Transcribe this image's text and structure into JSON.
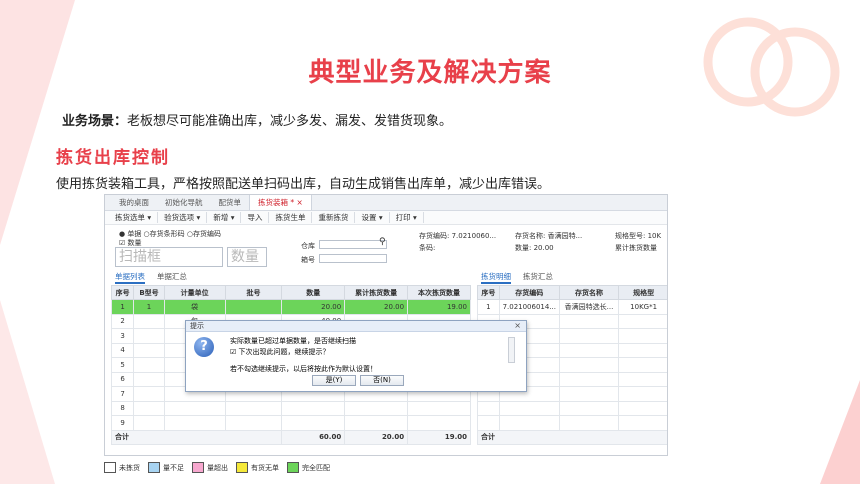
{
  "heading": "典型业务及解决方案",
  "scenario": {
    "label": "业务场景：",
    "text": "老板想尽可能准确出库，减少多发、漏发、发错货现象。"
  },
  "section": {
    "title": "拣货出库控制",
    "desc": "使用拣货装箱工具，严格按照配送单扫码出库，自动生成销售出库单，减少出库错误。"
  },
  "app": {
    "tabs": [
      "我的桌面",
      "初始化导航",
      "配货单",
      "拣货装箱 *"
    ],
    "tab_close": "×",
    "toolbar": [
      "拣货选单 ▾",
      "验货选项 ▾",
      "新增 ▾",
      "导入",
      "拣货生单",
      "重新拣货",
      "设置 ▾",
      "打印 ▾"
    ],
    "form": {
      "radio1": "● 单据 ○存货条形码 ○存货编码",
      "chk_qty": "☑ 数量",
      "scan_placeholder": "扫描框",
      "qty_placeholder": "数量",
      "warehouse_label": "仓库",
      "slot_label": "箱号",
      "inv_code": "存货编码: 7.0210060...",
      "inv_name": "存货名称: 香满园特...",
      "spec": "规格型号: 10K",
      "barcode": "条码:",
      "qty": "数量: 20.00",
      "acc_qty": "累计拣货数量"
    },
    "left_tabs": [
      "单据列表",
      "单据汇总"
    ],
    "right_tabs": [
      "拣货明细",
      "拣货汇总"
    ],
    "left_table": {
      "headers": [
        "序号",
        "B型号",
        "计量单位",
        "批号",
        "数量",
        "累计拣货数量",
        "本次拣货数量"
      ],
      "rows": [
        [
          "1",
          "1",
          "袋",
          "",
          "20.00",
          "20.00",
          "19.00"
        ],
        [
          "2",
          "",
          "包",
          "",
          "40.00",
          "",
          ""
        ],
        [
          "3",
          "",
          "",
          "",
          "",
          "",
          ""
        ],
        [
          "4",
          "",
          "",
          "",
          "",
          "",
          ""
        ],
        [
          "5",
          "",
          "",
          "",
          "",
          "",
          ""
        ],
        [
          "6",
          "",
          "",
          "",
          "",
          "",
          ""
        ],
        [
          "7",
          "",
          "",
          "",
          "",
          "",
          ""
        ],
        [
          "8",
          "",
          "",
          "",
          "",
          "",
          ""
        ],
        [
          "9",
          "",
          "",
          "",
          "",
          "",
          ""
        ]
      ],
      "total": [
        "合计",
        "",
        "",
        "",
        "60.00",
        "20.00",
        "19.00"
      ]
    },
    "right_table": {
      "headers": [
        "序号",
        "存货编码",
        "存货名称",
        "规格型"
      ],
      "rows": [
        [
          "1",
          "7.021006014...",
          "香满园特选长...",
          "10KG*1"
        ]
      ],
      "total_label": "合计"
    },
    "dialog": {
      "title": "提示",
      "close": "×",
      "icon": "?",
      "message": "实际数量已超过单据数量，是否继续扫描",
      "checkbox": "☑ 下次出现此问题，继续提示？",
      "note": "若不勾选继续提示，以后将按此作为默认设置！",
      "yes": "是(Y)",
      "no": "否(N)"
    }
  },
  "legend": [
    {
      "label": "未拣货",
      "color": "#ffffff"
    },
    {
      "label": "量不足",
      "color": "#a8d4f2"
    },
    {
      "label": "量超出",
      "color": "#f7a8cf"
    },
    {
      "label": "有货无单",
      "color": "#f5e93a"
    },
    {
      "label": "完全匹配",
      "color": "#6cd45a"
    }
  ],
  "colors": {
    "accent": "#e8404a",
    "match_green": "#6cd45a"
  }
}
